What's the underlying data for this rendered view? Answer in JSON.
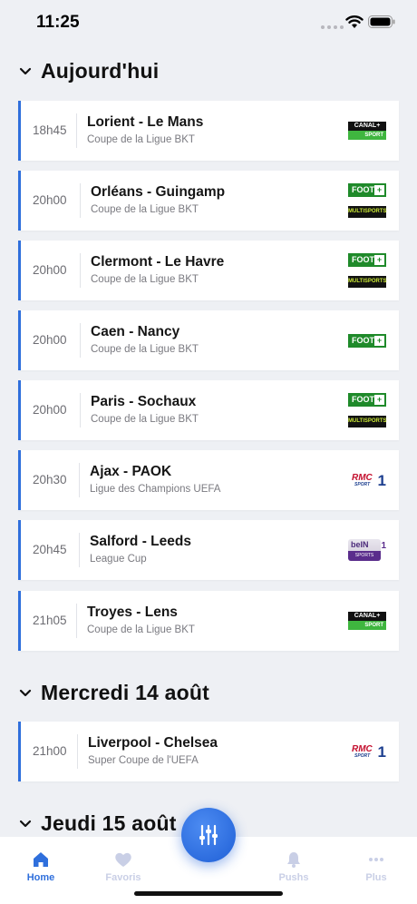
{
  "status": {
    "time": "11:25"
  },
  "sections": [
    {
      "title": "Aujourd'hui"
    },
    {
      "title": "Mercredi 14 août"
    },
    {
      "title": "Jeudi 15 août"
    }
  ],
  "matches": [
    {
      "time": "18h45",
      "teams": "Lorient - Le Mans",
      "competition": "Coupe de la Ligue BKT",
      "channels": [
        "Canal+ Sport"
      ]
    },
    {
      "time": "20h00",
      "teams": "Orléans - Guingamp",
      "competition": "Coupe de la Ligue BKT",
      "channels": [
        "Foot+",
        "Multisports"
      ]
    },
    {
      "time": "20h00",
      "teams": "Clermont - Le Havre",
      "competition": "Coupe de la Ligue BKT",
      "channels": [
        "Foot+",
        "Multisports"
      ]
    },
    {
      "time": "20h00",
      "teams": "Caen - Nancy",
      "competition": "Coupe de la Ligue BKT",
      "channels": [
        "Foot+"
      ]
    },
    {
      "time": "20h00",
      "teams": "Paris - Sochaux",
      "competition": "Coupe de la Ligue BKT",
      "channels": [
        "Foot+",
        "Multisports"
      ]
    },
    {
      "time": "20h30",
      "teams": "Ajax - PAOK",
      "competition": "Ligue des Champions UEFA",
      "channels": [
        "RMC Sport 1"
      ]
    },
    {
      "time": "20h45",
      "teams": "Salford - Leeds",
      "competition": "League Cup",
      "channels": [
        "beIN Sports 1"
      ]
    },
    {
      "time": "21h05",
      "teams": "Troyes - Lens",
      "competition": "Coupe de la Ligue BKT",
      "channels": [
        "Canal+ Sport"
      ]
    },
    {
      "time": "21h00",
      "teams": "Liverpool - Chelsea",
      "competition": "Super Coupe de l'UEFA",
      "channels": [
        "RMC Sport 1"
      ]
    }
  ],
  "logos": {
    "canal_top": "CANAL+",
    "canal_bottom": "SPORT",
    "foot": "FOOT",
    "foot_plus": "+",
    "multi": "MULTISPORTS",
    "rmc": "RMC",
    "rmc_sport": "SPORT",
    "rmc_num": "1",
    "bein": "beIN",
    "bein_sports": "SPORTS",
    "bein_num": "1"
  },
  "tabs": [
    {
      "label": "Home",
      "icon": "home-icon",
      "active": true
    },
    {
      "label": "Favoris",
      "icon": "heart-icon",
      "active": false
    },
    {
      "label": "Pushs",
      "icon": "bell-icon",
      "active": false
    },
    {
      "label": "Plus",
      "icon": "more-dots-icon",
      "active": false
    }
  ],
  "fab": {
    "icon": "filter-sliders-icon"
  },
  "colors": {
    "accent": "#2f6fdc",
    "background": "#eef0f4",
    "inactive_tab": "#c9cfe6"
  }
}
